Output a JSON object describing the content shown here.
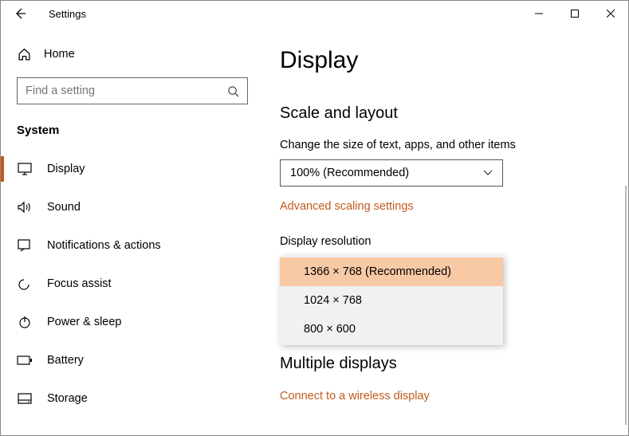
{
  "window_title": "Settings",
  "home_label": "Home",
  "search_placeholder": "Find a setting",
  "group_label": "System",
  "nav": [
    {
      "label": "Display"
    },
    {
      "label": "Sound"
    },
    {
      "label": "Notifications & actions"
    },
    {
      "label": "Focus assist"
    },
    {
      "label": "Power & sleep"
    },
    {
      "label": "Battery"
    },
    {
      "label": "Storage"
    }
  ],
  "page_title": "Display",
  "scale": {
    "heading": "Scale and layout",
    "change_label": "Change the size of text, apps, and other items",
    "current": "100% (Recommended)",
    "adv_link": "Advanced scaling settings"
  },
  "resolution": {
    "label": "Display resolution",
    "options": [
      "1366 × 768 (Recommended)",
      "1024 × 768",
      "800 × 600"
    ]
  },
  "multi": {
    "heading": "Multiple displays",
    "connect_link": "Connect to a wireless display"
  }
}
